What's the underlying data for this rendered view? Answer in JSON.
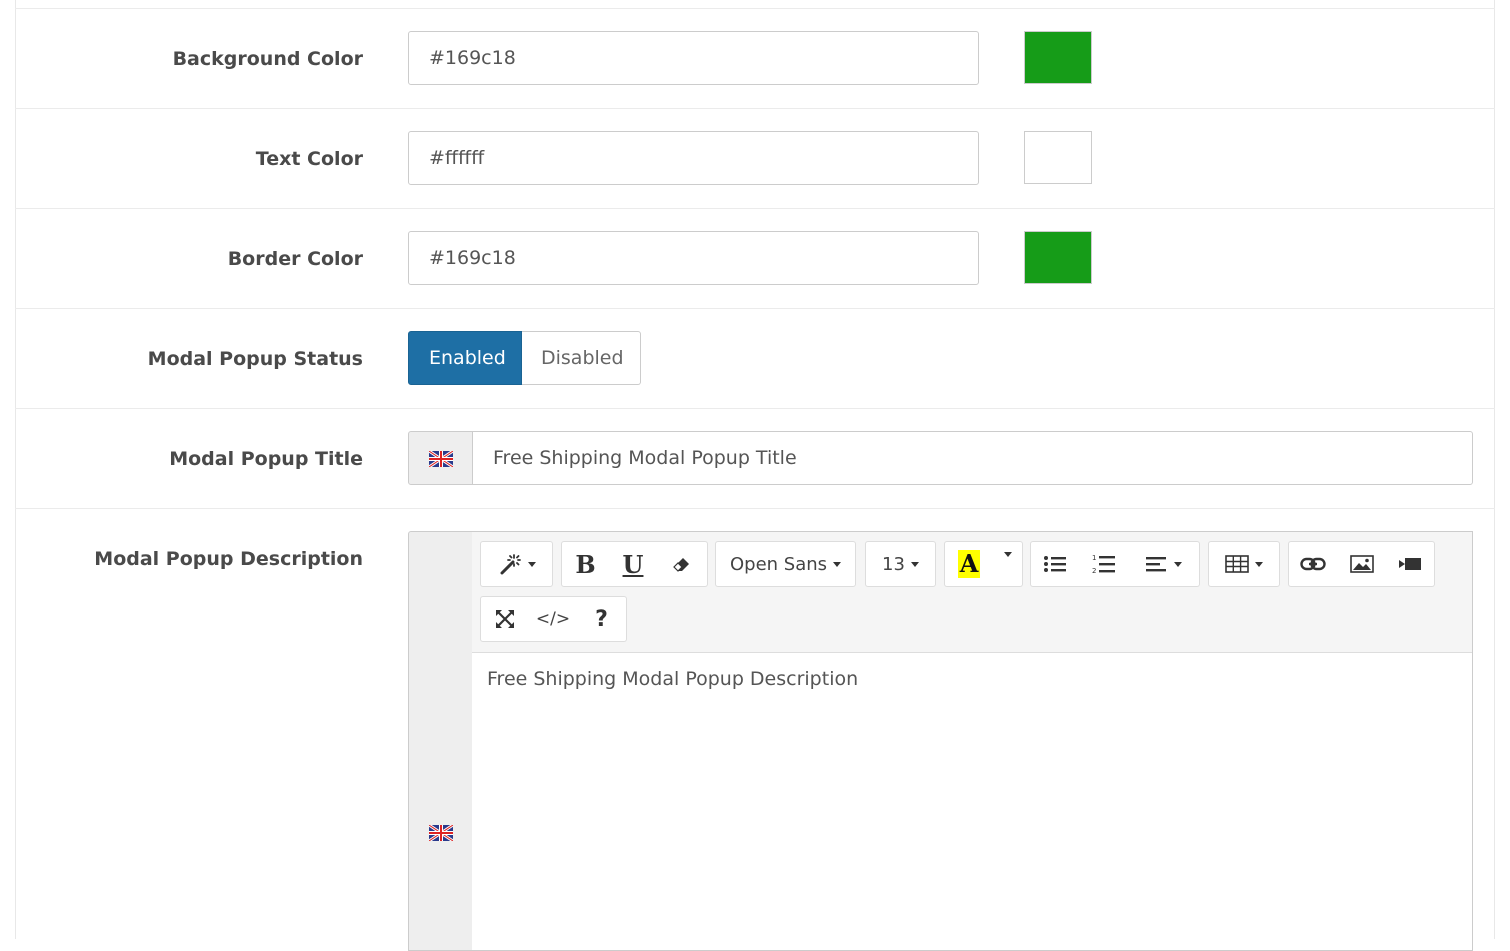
{
  "fields": {
    "background_color": {
      "label": "Background Color",
      "value": "#169c18",
      "swatch": "#169c18"
    },
    "text_color": {
      "label": "Text Color",
      "value": "#ffffff",
      "swatch": "#ffffff"
    },
    "border_color": {
      "label": "Border Color",
      "value": "#169c18",
      "swatch": "#169c18"
    },
    "modal_status": {
      "label": "Modal Popup Status",
      "enabled": "Enabled",
      "disabled": "Disabled",
      "selected": "Enabled"
    },
    "modal_title": {
      "label": "Modal Popup Title",
      "value": "Free Shipping  Modal Popup Title",
      "flag_icon": "uk-flag-icon"
    },
    "modal_description": {
      "label": "Modal Popup Description",
      "content": "Free Shipping  Modal Popup Description",
      "flag_icon": "uk-flag-icon"
    }
  },
  "editor_toolbar": {
    "font_name": "Open Sans",
    "font_size": "13",
    "bold": "B",
    "underline": "U",
    "highlight_letter": "A",
    "code_view": "</>",
    "help": "?",
    "icons": [
      "magic-wand-icon",
      "bold-icon",
      "underline-icon",
      "eraser-icon",
      "color-icon",
      "unordered-list-icon",
      "ordered-list-icon",
      "align-icon",
      "table-icon",
      "link-icon",
      "picture-icon",
      "video-icon",
      "fullscreen-icon",
      "code-view-icon",
      "help-icon"
    ]
  },
  "colors": {
    "primary": "#1e6fa5",
    "swatch_green": "#169c18"
  }
}
